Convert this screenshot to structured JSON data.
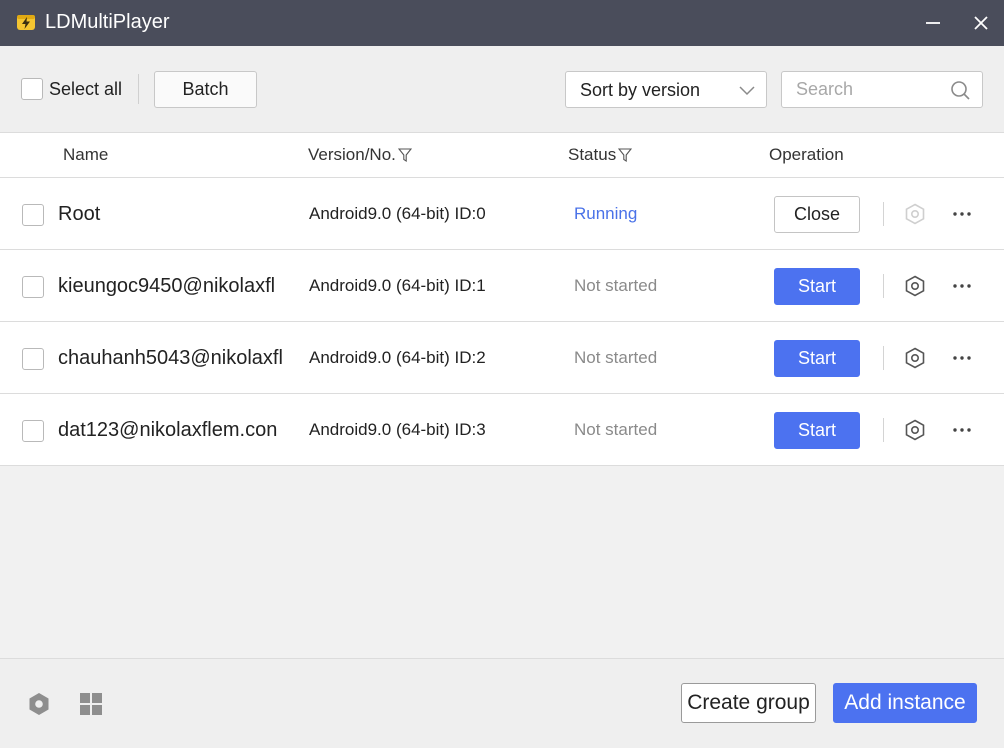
{
  "window": {
    "title": "LDMultiPlayer",
    "accent_color": "#4c72f0",
    "titlebar_color": "#4a4d5b",
    "logo_icon": "lightning-bolt-logo",
    "controls": [
      "minimize-icon",
      "close-icon"
    ]
  },
  "toolbar": {
    "select_all_label": "Select all",
    "batch_label": "Batch",
    "sort_selected": "Sort by version",
    "search_placeholder": "Search",
    "search_value": ""
  },
  "table": {
    "headers": {
      "name": "Name",
      "version": "Version/No.",
      "status": "Status",
      "operation": "Operation"
    },
    "rows": [
      {
        "name": "Root",
        "version": "Android9.0 (64-bit) ID:0",
        "status": "Running",
        "action": "Close"
      },
      {
        "name": "kieungoc9450@nikolaxfl",
        "version": "Android9.0 (64-bit) ID:1",
        "status": "Not started",
        "action": "Start"
      },
      {
        "name": "chauhanh5043@nikolaxfl",
        "version": "Android9.0 (64-bit) ID:2",
        "status": "Not started",
        "action": "Start"
      },
      {
        "name": "dat123@nikolaxflem.con",
        "version": "Android9.0 (64-bit) ID:3",
        "status": "Not started",
        "action": "Start"
      }
    ],
    "status_colors": {
      "running": "#4a72e8",
      "not_started": "#8a8a8a"
    }
  },
  "footer": {
    "create_group_label": "Create group",
    "add_instance_label": "Add instance",
    "icons": [
      "settings-icon",
      "grid-icon"
    ]
  }
}
